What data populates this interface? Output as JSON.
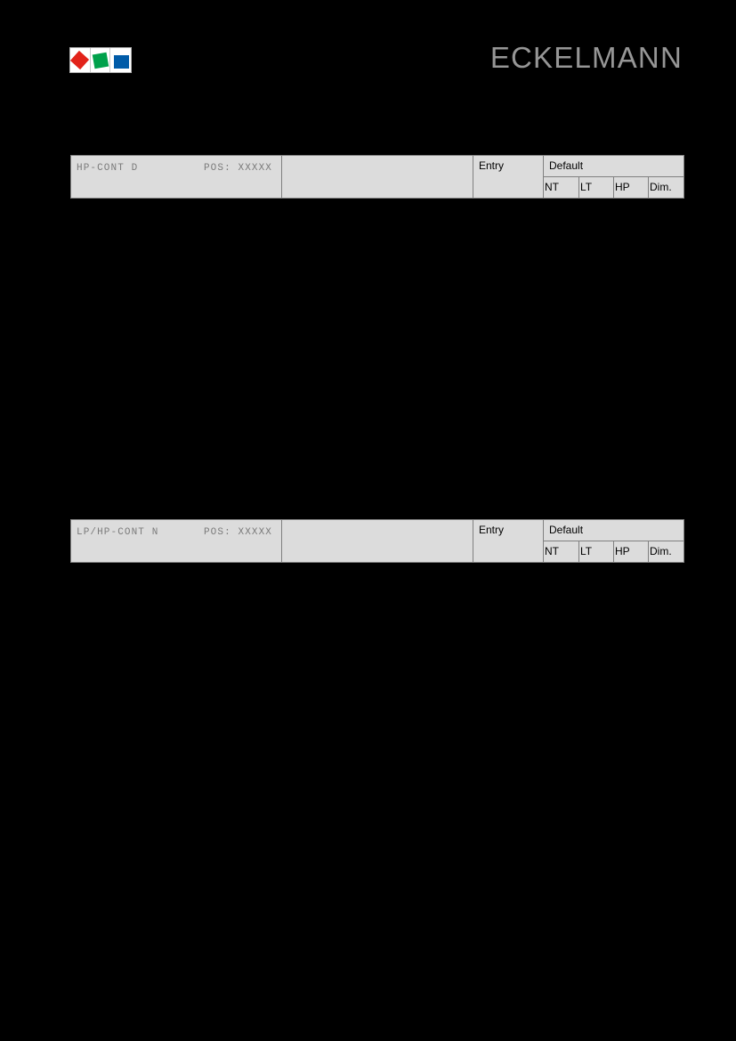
{
  "brand": {
    "wordmark": "ECKELMANN",
    "logo_tiles": [
      {
        "icon": "red-diamond-icon",
        "color": "#e2231a"
      },
      {
        "icon": "green-square-icon",
        "color": "#00a14b"
      },
      {
        "icon": "blue-square-icon",
        "color": "#005ba8"
      }
    ]
  },
  "page": {
    "background": "#000000",
    "table_fill": "#dcdcdc",
    "table_border": "#808080",
    "mono_text_color": "#7b7b7b"
  },
  "tables": [
    {
      "device_name": "HP-CONT D",
      "position_label": "POS: XXXXX",
      "description": "",
      "entry_header": "Entry",
      "default_header": "Default",
      "sub_headers": [
        "NT",
        "LT",
        "HP",
        "Dim."
      ],
      "rows": []
    },
    {
      "device_name": "LP/HP-CONT N",
      "position_label": "POS: XXXXX",
      "description": "",
      "entry_header": "Entry",
      "default_header": "Default",
      "sub_headers": [
        "NT",
        "LT",
        "HP",
        "Dim."
      ],
      "rows": []
    }
  ]
}
